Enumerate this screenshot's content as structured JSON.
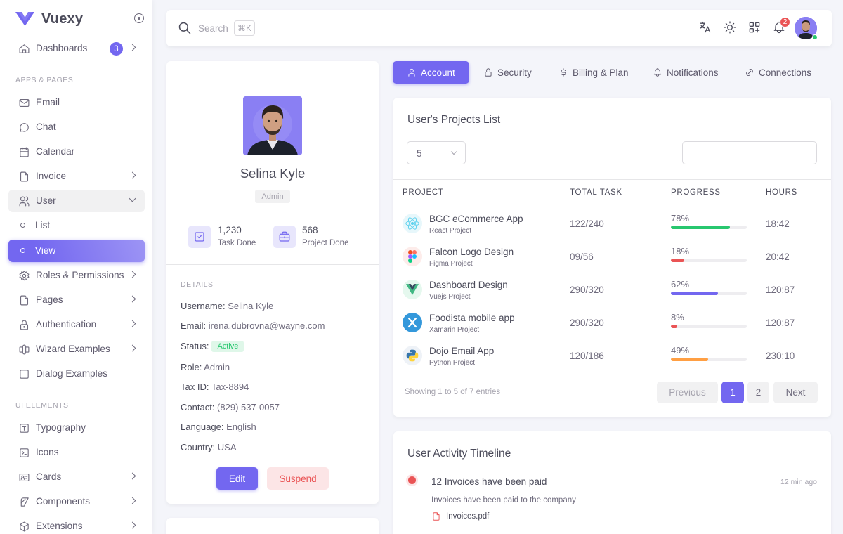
{
  "sidebar": {
    "brand": "Vuexy",
    "dashboards": {
      "label": "Dashboards",
      "badge": "3"
    },
    "section_apps": "APPS & PAGES",
    "email": "Email",
    "chat": "Chat",
    "calendar": "Calendar",
    "invoice": "Invoice",
    "user": "User",
    "user_list": "List",
    "user_view": "View",
    "roles": "Roles & Permissions",
    "pages": "Pages",
    "authentication": "Authentication",
    "wizard": "Wizard Examples",
    "dialog": "Dialog Examples",
    "section_ui": "UI ELEMENTS",
    "typography": "Typography",
    "icons": "Icons",
    "cards": "Cards",
    "components": "Components",
    "extensions": "Extensions"
  },
  "navbar": {
    "search_placeholder": "Search",
    "shortcut": "⌘K",
    "notification_count": "2"
  },
  "user": {
    "name": "Selina Kyle",
    "role": "Admin",
    "tasks_done": "1,230",
    "tasks_done_label": "Task Done",
    "projects_done": "568",
    "projects_done_label": "Project Done",
    "details_header": "DETAILS",
    "details": [
      {
        "label": "Username:",
        "value": "Selina Kyle"
      },
      {
        "label": "Email:",
        "value": "irena.dubrovna@wayne.com"
      },
      {
        "label": "Status:",
        "value": "Active"
      },
      {
        "label": "Role:",
        "value": "Admin"
      },
      {
        "label": "Tax ID:",
        "value": "Tax-8894"
      },
      {
        "label": "Contact:",
        "value": "(829) 537-0057"
      },
      {
        "label": "Language:",
        "value": "English"
      },
      {
        "label": "Country:",
        "value": "USA"
      }
    ],
    "edit_label": "Edit",
    "suspend_label": "Suspend"
  },
  "tabs": [
    "Account",
    "Security",
    "Billing & Plan",
    "Notifications",
    "Connections"
  ],
  "projects": {
    "title": "User's Projects List",
    "page_size": "5",
    "columns": [
      "PROJECT",
      "TOTAL TASK",
      "PROGRESS",
      "HOURS"
    ],
    "rows": [
      {
        "name": "BGC eCommerce App",
        "sub": "React Project",
        "tasks": "122/240",
        "progress": "78%",
        "fraction": 0.78,
        "color": "#28c76f",
        "hours": "18:42",
        "icon": "react-icon"
      },
      {
        "name": "Falcon Logo Design",
        "sub": "Figma Project",
        "tasks": "09/56",
        "progress": "18%",
        "fraction": 0.18,
        "color": "#ea5455",
        "hours": "20:42",
        "icon": "figma-icon"
      },
      {
        "name": "Dashboard Design",
        "sub": "Vuejs Project",
        "tasks": "290/320",
        "progress": "62%",
        "fraction": 0.62,
        "color": "#7367f0",
        "hours": "120:87",
        "icon": "vue-icon"
      },
      {
        "name": "Foodista mobile app",
        "sub": "Xamarin Project",
        "tasks": "290/320",
        "progress": "8%",
        "fraction": 0.08,
        "color": "#ea5455",
        "hours": "120:87",
        "icon": "xamarin-icon"
      },
      {
        "name": "Dojo Email App",
        "sub": "Python Project",
        "tasks": "120/186",
        "progress": "49%",
        "fraction": 0.49,
        "color": "#ff9f43",
        "hours": "230:10",
        "icon": "python-icon"
      }
    ],
    "showing": "Showing 1 to 5 of 7 entries",
    "prev": "Previous",
    "page1": "1",
    "page2": "2",
    "next": "Next"
  },
  "timeline": {
    "title": "User Activity Timeline",
    "event_title": "12 Invoices have been paid",
    "event_time": "12 min ago",
    "event_desc": "Invoices have been paid to the company",
    "event_file": "Invoices.pdf"
  },
  "colors": {
    "primary": "#7367f0",
    "success": "#28c76f",
    "danger": "#ea5455",
    "warning": "#ff9f43"
  }
}
